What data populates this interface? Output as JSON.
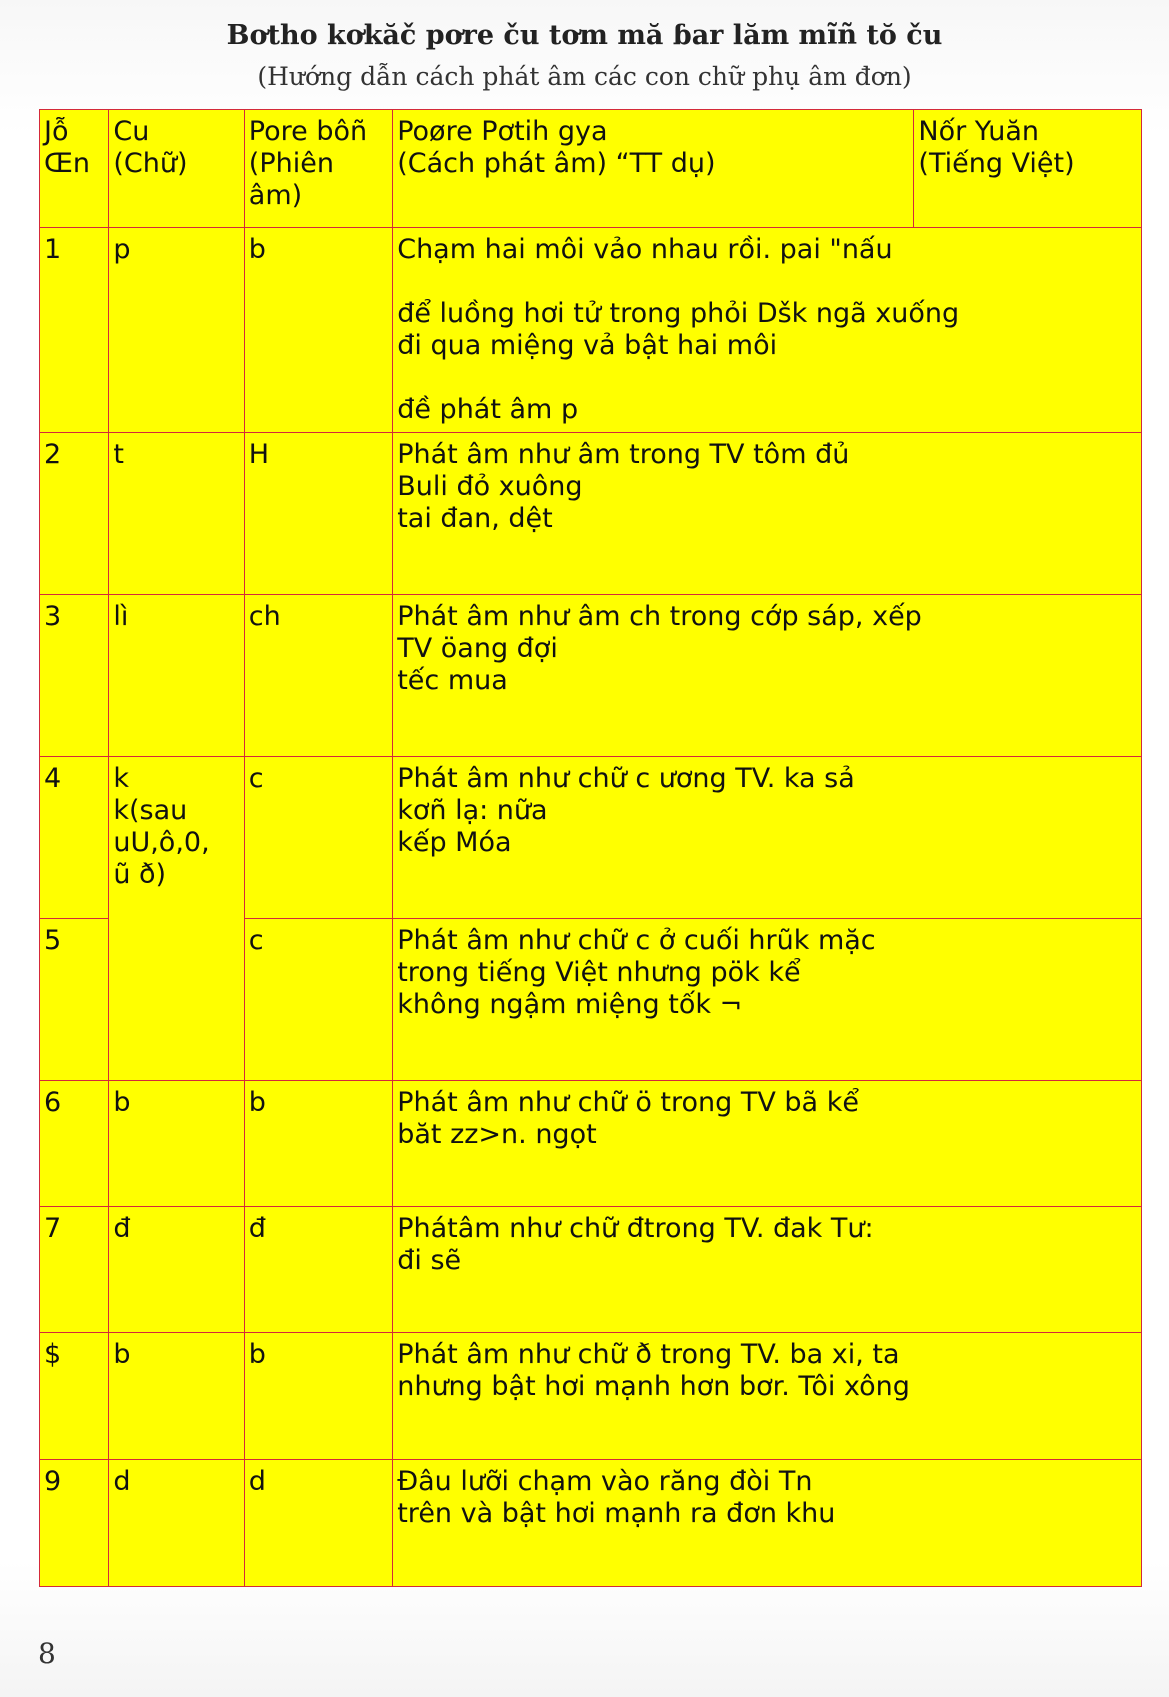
{
  "header": {
    "title": "Bơtho kơkăč pơre ču tơm mă ɓar lăm mĩñ tŏ ču",
    "subtitle": "(Hướng dẫn cách phát âm các con chữ phụ âm đơn)"
  },
  "table": {
    "columns": [
      {
        "line1": "Jỗ",
        "line2": "Œn"
      },
      {
        "line1": "Cu",
        "line2": "(Chữ)"
      },
      {
        "line1": "Pore bôñ",
        "line2": "(Phiên âm)"
      },
      {
        "line1": "Poøre Pơtih gya",
        "line2": "(Cách phát âm) “TT dụ)"
      },
      {
        "line1": "Nốr Yuăn",
        "line2": "(Tiếng Việt)"
      }
    ],
    "rows": [
      {
        "no": "1",
        "letter": "p",
        "phonetic": "b",
        "description": "Chạm hai môi vảo nhau rồi. pai \"nấu\n\nđể luồng hơi tử trong phỏi Dšk ngã xuống\nđi qua miệng vả bật hai môi\n\nđề phát âm p"
      },
      {
        "no": "2",
        "letter": "t",
        "phonetic": "H",
        "description": "Phát âm như âm trong TV tôm đủ\nBuli đỏ xuông\ntai đan, dệt"
      },
      {
        "no": "3",
        "letter": "lì",
        "phonetic": "ch",
        "description": "Phát âm như âm ch trong cớp sáp, xếp\nTV öang đợi\ntếc mua"
      },
      {
        "no": "4",
        "letter": "k\nk(sau\nuU,ô,0,\nũ ð)",
        "phonetic": "c",
        "description": "Phát âm như chữ c ương TV. ka sả\nkơñ lạ: nữa\nkếp Móa"
      },
      {
        "no": "5",
        "phonetic": "c",
        "description": "Phát âm như chữ c ở cuối hrũk mặc\ntrong tiếng Việt nhưng pök kể\nkhông ngậm miệng tốk ¬"
      },
      {
        "no": "6",
        "letter": "b",
        "phonetic": "b",
        "description": "Phát âm như chữ ö trong TV bã kể\nbăt zz>n. ngọt"
      },
      {
        "no": "7",
        "letter": "đ",
        "phonetic": "đ",
        "description": "Phátâm như chữ đtrong TV. đak Tư:\nđi sẽ"
      },
      {
        "no": "$",
        "letter": "b",
        "phonetic": "b",
        "description": "Phát âm như chữ ð trong TV. ba xi, ta\nnhưng bật hơi mạnh hơn bơr. Tôi xông"
      },
      {
        "no": "9",
        "letter": "d",
        "phonetic": "d",
        "description": "Đâu lưỡi chạm vào răng đòi Tn\ntrên và bật hơi mạnh ra đơn khu"
      }
    ]
  },
  "footer": {
    "page_number": "8"
  },
  "colors": {
    "cell_fill": "#ffff00",
    "grid_line": "#d42a3a"
  }
}
